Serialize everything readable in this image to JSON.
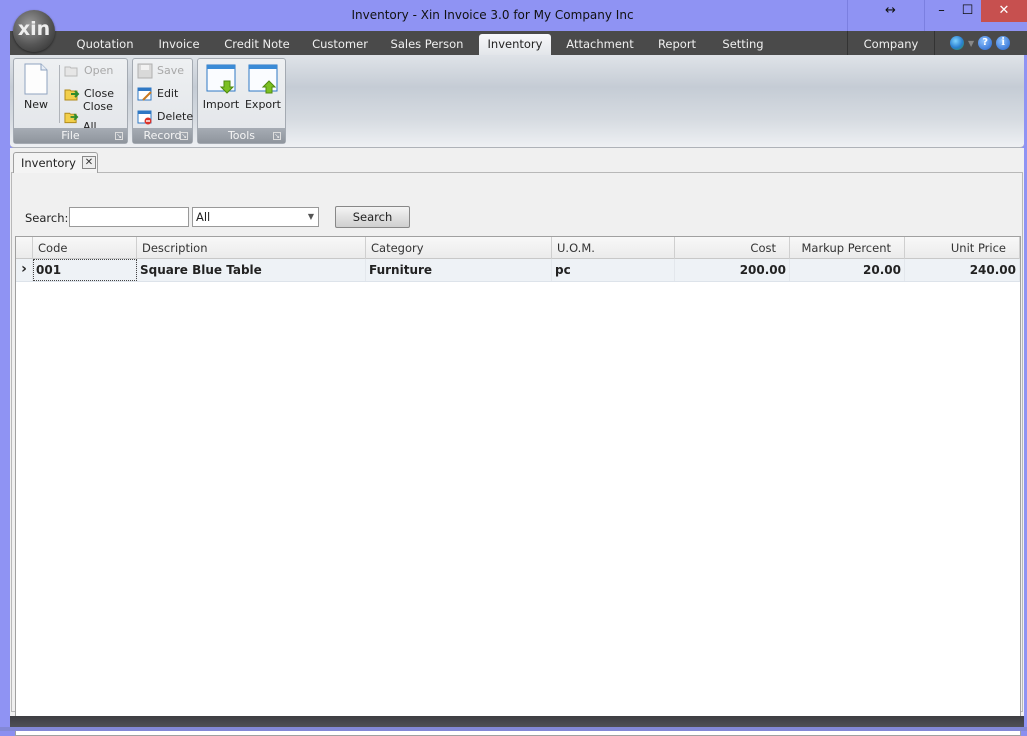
{
  "window": {
    "title": "Inventory - Xin Invoice 3.0 for My Company Inc",
    "logo_text": "xin",
    "controls": {
      "resize": "↔",
      "minimize": "–",
      "maximize": "☐",
      "close": "✕"
    }
  },
  "menu": {
    "tabs": [
      {
        "label": "Quotation"
      },
      {
        "label": "Invoice"
      },
      {
        "label": "Credit Note"
      },
      {
        "label": "Customer"
      },
      {
        "label": "Sales Person"
      },
      {
        "label": "Inventory",
        "active": true
      },
      {
        "label": "Attachment"
      },
      {
        "label": "Report"
      },
      {
        "label": "Setting"
      }
    ],
    "company_label": "Company",
    "help_glyph": "?",
    "info_glyph": "i"
  },
  "ribbon": {
    "groups": {
      "file": {
        "label": "File",
        "new": "New",
        "open": "Open",
        "close": "Close",
        "close_all": "Close All"
      },
      "record": {
        "label": "Record",
        "save": "Save",
        "edit": "Edit",
        "delete": "Delete"
      },
      "tools": {
        "label": "Tools",
        "import": "Import",
        "export": "Export"
      }
    }
  },
  "document_tab": {
    "label": "Inventory",
    "close_glyph": "✕"
  },
  "search": {
    "label": "Search:",
    "input_value": "",
    "category_selected": "All",
    "button_label": "Search"
  },
  "grid": {
    "columns": [
      "Code",
      "Description",
      "Category",
      "U.O.M.",
      "Cost",
      "Markup Percent",
      "Unit Price"
    ],
    "rows": [
      {
        "code": "001",
        "description": "Square Blue Table",
        "category": "Furniture",
        "uom": "pc",
        "cost": "200.00",
        "markup": "20.00",
        "unit_price": "240.00"
      }
    ],
    "row_indicator": "›"
  }
}
